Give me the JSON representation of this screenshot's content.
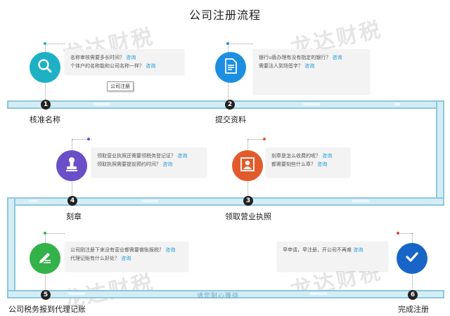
{
  "title": "公司注册流程",
  "watermark": "龙达财税",
  "tooltip": "公司注册",
  "bottom_text": "请您耐心等待",
  "ask_label": "咨询",
  "colors": {
    "step1": "#1eb0c4",
    "step2": "#1d8fe3",
    "step3": "#e25b2c",
    "step4": "#6a4fc8",
    "step5": "#33b24a",
    "step6": "#1766c7",
    "pipe_fill": "#d4edf5",
    "pipe_border": "#8cc8dd",
    "ask_link": "#1a9ad6"
  },
  "steps": [
    {
      "num": "1",
      "label": "核准名称",
      "icon": "search-icon",
      "questions": [
        "名称审核需要多长时间？",
        "个体户的名称能和公司名称一样？"
      ]
    },
    {
      "num": "2",
      "label": "提交资料",
      "icon": "document-icon",
      "questions": [
        "银行u盾办理有没有指定的银行？",
        "需要法人到场签字？"
      ]
    },
    {
      "num": "3",
      "label": "领取营业执照",
      "icon": "license-portrait-icon",
      "questions": [
        "刻章是怎么收费的呢？",
        "都需要刻些什么章？"
      ]
    },
    {
      "num": "4",
      "label": "刻章",
      "icon": "stamp-icon",
      "questions": [
        "领取营业执照还需要领税务登记证？",
        "领取执照需要提前预约时间？"
      ]
    },
    {
      "num": "5",
      "label": "公司税务报到代理记账",
      "icon": "pen-icon",
      "questions": [
        "公司刚注册下来没有营业都需要做账报税？",
        "代理记账有什么好处？"
      ]
    },
    {
      "num": "6",
      "label": "完成注册",
      "icon": "checkmark-icon",
      "questions": [
        "早申请，早注册，开公司不再难"
      ]
    }
  ]
}
